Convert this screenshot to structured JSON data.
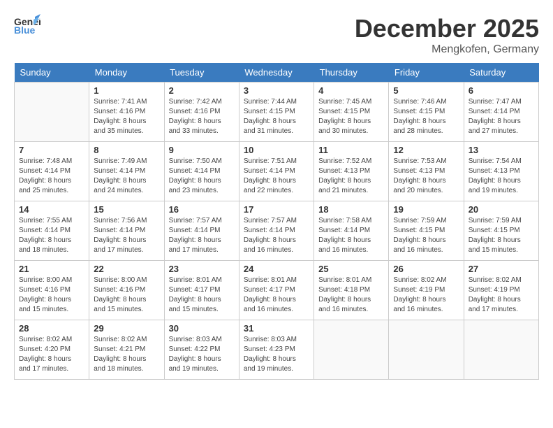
{
  "header": {
    "logo_general": "General",
    "logo_blue": "Blue",
    "month": "December 2025",
    "location": "Mengkofen, Germany"
  },
  "days_of_week": [
    "Sunday",
    "Monday",
    "Tuesday",
    "Wednesday",
    "Thursday",
    "Friday",
    "Saturday"
  ],
  "weeks": [
    [
      {
        "day": "",
        "info": ""
      },
      {
        "day": "1",
        "info": "Sunrise: 7:41 AM\nSunset: 4:16 PM\nDaylight: 8 hours\nand 35 minutes."
      },
      {
        "day": "2",
        "info": "Sunrise: 7:42 AM\nSunset: 4:16 PM\nDaylight: 8 hours\nand 33 minutes."
      },
      {
        "day": "3",
        "info": "Sunrise: 7:44 AM\nSunset: 4:15 PM\nDaylight: 8 hours\nand 31 minutes."
      },
      {
        "day": "4",
        "info": "Sunrise: 7:45 AM\nSunset: 4:15 PM\nDaylight: 8 hours\nand 30 minutes."
      },
      {
        "day": "5",
        "info": "Sunrise: 7:46 AM\nSunset: 4:15 PM\nDaylight: 8 hours\nand 28 minutes."
      },
      {
        "day": "6",
        "info": "Sunrise: 7:47 AM\nSunset: 4:14 PM\nDaylight: 8 hours\nand 27 minutes."
      }
    ],
    [
      {
        "day": "7",
        "info": "Sunrise: 7:48 AM\nSunset: 4:14 PM\nDaylight: 8 hours\nand 25 minutes."
      },
      {
        "day": "8",
        "info": "Sunrise: 7:49 AM\nSunset: 4:14 PM\nDaylight: 8 hours\nand 24 minutes."
      },
      {
        "day": "9",
        "info": "Sunrise: 7:50 AM\nSunset: 4:14 PM\nDaylight: 8 hours\nand 23 minutes."
      },
      {
        "day": "10",
        "info": "Sunrise: 7:51 AM\nSunset: 4:14 PM\nDaylight: 8 hours\nand 22 minutes."
      },
      {
        "day": "11",
        "info": "Sunrise: 7:52 AM\nSunset: 4:13 PM\nDaylight: 8 hours\nand 21 minutes."
      },
      {
        "day": "12",
        "info": "Sunrise: 7:53 AM\nSunset: 4:13 PM\nDaylight: 8 hours\nand 20 minutes."
      },
      {
        "day": "13",
        "info": "Sunrise: 7:54 AM\nSunset: 4:13 PM\nDaylight: 8 hours\nand 19 minutes."
      }
    ],
    [
      {
        "day": "14",
        "info": "Sunrise: 7:55 AM\nSunset: 4:14 PM\nDaylight: 8 hours\nand 18 minutes."
      },
      {
        "day": "15",
        "info": "Sunrise: 7:56 AM\nSunset: 4:14 PM\nDaylight: 8 hours\nand 17 minutes."
      },
      {
        "day": "16",
        "info": "Sunrise: 7:57 AM\nSunset: 4:14 PM\nDaylight: 8 hours\nand 17 minutes."
      },
      {
        "day": "17",
        "info": "Sunrise: 7:57 AM\nSunset: 4:14 PM\nDaylight: 8 hours\nand 16 minutes."
      },
      {
        "day": "18",
        "info": "Sunrise: 7:58 AM\nSunset: 4:14 PM\nDaylight: 8 hours\nand 16 minutes."
      },
      {
        "day": "19",
        "info": "Sunrise: 7:59 AM\nSunset: 4:15 PM\nDaylight: 8 hours\nand 16 minutes."
      },
      {
        "day": "20",
        "info": "Sunrise: 7:59 AM\nSunset: 4:15 PM\nDaylight: 8 hours\nand 15 minutes."
      }
    ],
    [
      {
        "day": "21",
        "info": "Sunrise: 8:00 AM\nSunset: 4:16 PM\nDaylight: 8 hours\nand 15 minutes."
      },
      {
        "day": "22",
        "info": "Sunrise: 8:00 AM\nSunset: 4:16 PM\nDaylight: 8 hours\nand 15 minutes."
      },
      {
        "day": "23",
        "info": "Sunrise: 8:01 AM\nSunset: 4:17 PM\nDaylight: 8 hours\nand 15 minutes."
      },
      {
        "day": "24",
        "info": "Sunrise: 8:01 AM\nSunset: 4:17 PM\nDaylight: 8 hours\nand 16 minutes."
      },
      {
        "day": "25",
        "info": "Sunrise: 8:01 AM\nSunset: 4:18 PM\nDaylight: 8 hours\nand 16 minutes."
      },
      {
        "day": "26",
        "info": "Sunrise: 8:02 AM\nSunset: 4:19 PM\nDaylight: 8 hours\nand 16 minutes."
      },
      {
        "day": "27",
        "info": "Sunrise: 8:02 AM\nSunset: 4:19 PM\nDaylight: 8 hours\nand 17 minutes."
      }
    ],
    [
      {
        "day": "28",
        "info": "Sunrise: 8:02 AM\nSunset: 4:20 PM\nDaylight: 8 hours\nand 17 minutes."
      },
      {
        "day": "29",
        "info": "Sunrise: 8:02 AM\nSunset: 4:21 PM\nDaylight: 8 hours\nand 18 minutes."
      },
      {
        "day": "30",
        "info": "Sunrise: 8:03 AM\nSunset: 4:22 PM\nDaylight: 8 hours\nand 19 minutes."
      },
      {
        "day": "31",
        "info": "Sunrise: 8:03 AM\nSunset: 4:23 PM\nDaylight: 8 hours\nand 19 minutes."
      },
      {
        "day": "",
        "info": ""
      },
      {
        "day": "",
        "info": ""
      },
      {
        "day": "",
        "info": ""
      }
    ]
  ]
}
